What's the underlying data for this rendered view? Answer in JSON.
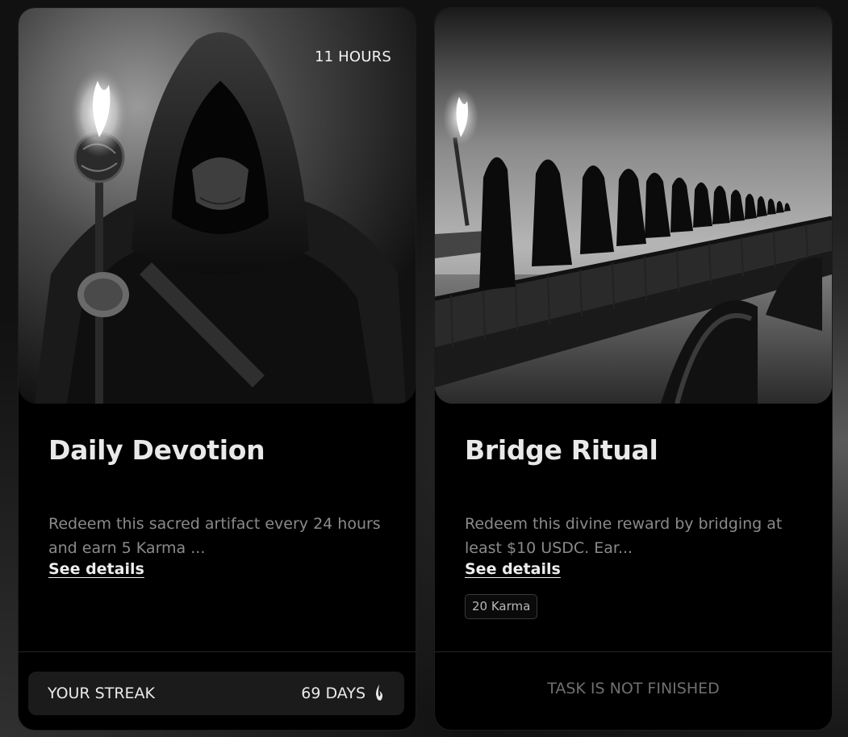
{
  "cards": [
    {
      "image_icon": "hooded-figure-with-torch",
      "timer": "11 HOURS",
      "title": "Daily Devotion",
      "description": "Redeem this sacred artifact every 24 hours and earn 5 Karma ...",
      "details_link": "See details",
      "streak": {
        "label": "YOUR STREAK",
        "value": "69 DAYS",
        "icon": "flame-icon"
      }
    },
    {
      "image_icon": "robed-procession-on-bridge",
      "title": "Bridge Ritual",
      "description": "Redeem this divine reward by bridging at least $10 USDC. Ear...",
      "details_link": "See details",
      "badge": "20 Karma",
      "status": "TASK IS NOT FINISHED"
    }
  ],
  "colors": {
    "card_bg": "#000000",
    "title": "#e9e9e9",
    "muted": "#8a8a8a",
    "streak_bg": "#1b1b1b"
  }
}
